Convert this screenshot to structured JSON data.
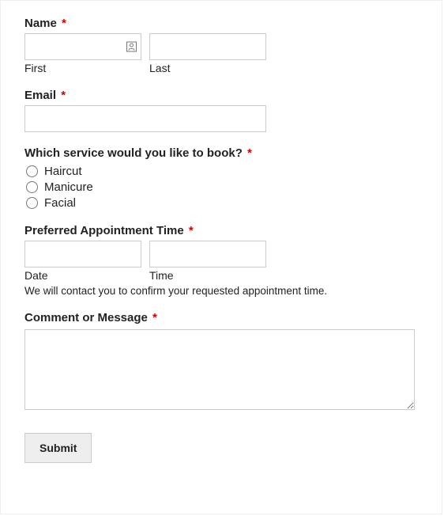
{
  "required_marker": "*",
  "name": {
    "label": "Name",
    "first_value": "",
    "first_sublabel": "First",
    "last_value": "",
    "last_sublabel": "Last"
  },
  "email": {
    "label": "Email",
    "value": ""
  },
  "service": {
    "label": "Which service would you like to book?",
    "options": [
      "Haircut",
      "Manicure",
      "Facial"
    ]
  },
  "appointment": {
    "label": "Preferred Appointment Time",
    "date_value": "",
    "date_sublabel": "Date",
    "time_value": "",
    "time_sublabel": "Time",
    "hint": "We will contact you to confirm your requested appointment time."
  },
  "comment": {
    "label": "Comment or Message",
    "value": ""
  },
  "submit_label": "Submit"
}
